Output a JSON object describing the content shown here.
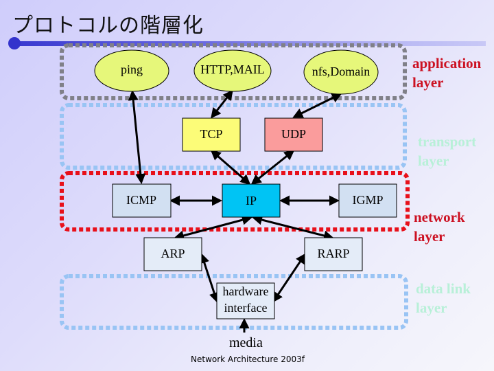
{
  "title": "プロトコルの階層化",
  "layers": [
    {
      "id": "application",
      "label_line1": "application",
      "label_line2": "layer",
      "label_color": "#cc1122",
      "border_color": "#808088"
    },
    {
      "id": "transport",
      "label_line1": "transport",
      "label_line2": "layer",
      "label_color": "#b8f0d8",
      "border_color": "#99c4f4"
    },
    {
      "id": "network",
      "label_line1": "network",
      "label_line2": "layer",
      "label_color": "#cc1122",
      "border_color": "#e8101a"
    },
    {
      "id": "datalink",
      "label_line1": "data link",
      "label_line2": "layer",
      "label_color": "#b8f0d8",
      "border_color": "#99c4f4"
    }
  ],
  "nodes": {
    "ping": {
      "label": "ping",
      "fill": "#e6f77a"
    },
    "http_mail": {
      "label": "HTTP,MAIL",
      "fill": "#e6f77a"
    },
    "nfs_domain": {
      "label": "nfs,Domain",
      "fill": "#e6f77a"
    },
    "tcp": {
      "label": "TCP",
      "fill": "#fcfc78"
    },
    "udp": {
      "label": "UDP",
      "fill": "#fa9c9c"
    },
    "icmp": {
      "label": "ICMP",
      "fill": "#d2e0f2"
    },
    "ip": {
      "label": "IP",
      "fill": "#00c4f4"
    },
    "igmp": {
      "label": "IGMP",
      "fill": "#d2e0f2"
    },
    "arp": {
      "label": "ARP",
      "fill": "#e4ecf8"
    },
    "rarp": {
      "label": "RARP",
      "fill": "#e4ecf8"
    },
    "hw_line1": {
      "label": "hardware"
    },
    "hw_line2": {
      "label": "interface",
      "fill": "#e4ecf8"
    }
  },
  "media": "media",
  "footer": "Network Architecture 2003f"
}
